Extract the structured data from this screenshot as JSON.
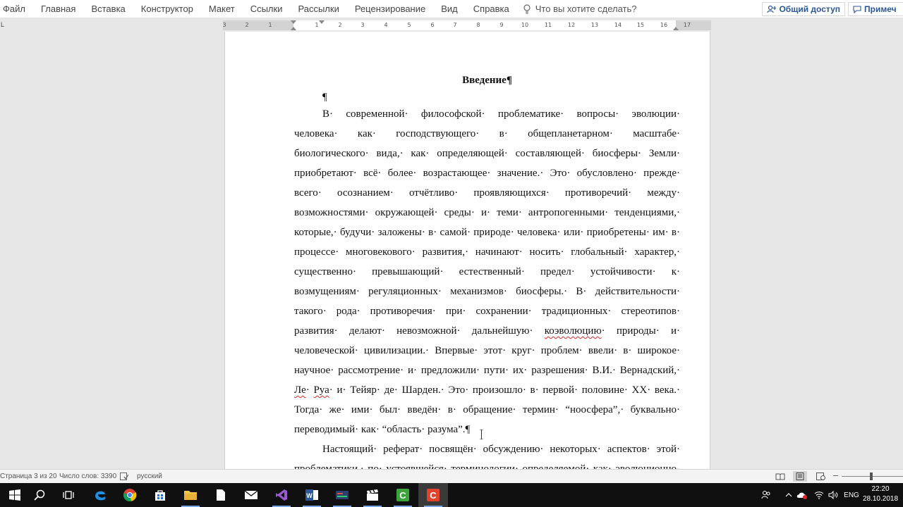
{
  "ribbon": {
    "tabs": [
      "Файл",
      "Главная",
      "Вставка",
      "Конструктор",
      "Макет",
      "Ссылки",
      "Рассылки",
      "Рецензирование",
      "Вид",
      "Справка"
    ],
    "tell_me": "Что вы хотите сделать?",
    "share_label": "Общий доступ",
    "notes_label": "Примеч"
  },
  "ruler": {
    "tab_selector": "L",
    "left_ticks": [
      "3",
      "2",
      "1"
    ],
    "ticks": [
      "1",
      "2",
      "3",
      "4",
      "5",
      "6",
      "7",
      "8",
      "9",
      "10",
      "11",
      "12",
      "13",
      "14",
      "15",
      "16",
      "17"
    ]
  },
  "document": {
    "heading": "Введение¶",
    "empty_paragraph": "¶",
    "lines": [
      "В· современной· философской· проблематике· вопросы· эволюции·",
      "человека· как· господствующего· в· общепланетарном· масштабе·",
      "биологического· вида,· как· определяющей· составляющей· биосферы· Земли·",
      "приобретают· всё· более· возрастающее· значение.· Это· обусловлено· прежде·",
      "всего· осознанием· отчётливо· проявляющихся· противоречий· между·",
      "возможностями· окружающей· среды· и· теми· антропогенными· тенденциями,·",
      "которые,· будучи· заложены· в· самой· природе· человека· или· приобретены· им· в·",
      "процессе· многовекового· развития,· начинают· носить· глобальный· характер,·",
      "существенно· превышающий· естественный· предел· устойчивости· к·",
      "возмущениям· регуляционных· механизмов· биосферы.· В· действительности·",
      "такого· рода· противоречия· при· сохранении· традиционных· стереотипов·",
      "развития· делают· невозможной· дальнейшую· ",
      "коэволюцию",
      "· природы· и·",
      "человеческой· цивилизации.· Впервые· этот· круг· проблем· ввели· в· широкое·",
      "научное· рассмотрение· и· предложили· пути· их· разрешения· В.И.· Вернадский,·",
      "Ле",
      "· ",
      "Руа",
      "· и· Тейяр· де· Шарден.· Это· произошло· в· первой· половине· XX· века.·",
      "Тогда· же· ими· был· введён· в· обращение· термин· “ноосфера”,· буквально·",
      "переводимый· как· “область· разума”.¶",
      "Настоящий· реферат· посвящён· обсуждению· некоторых· аспектов· этой·",
      "проблематики,· по· устоявшейся· терминологии· определяемой· как· эволюционно-"
    ]
  },
  "status": {
    "page": "Страница 3 из 20",
    "words": "Число слов: 3390",
    "language": "русский"
  },
  "tray": {
    "lang": "ENG",
    "time": "22:20",
    "date": "28.10.2018"
  }
}
